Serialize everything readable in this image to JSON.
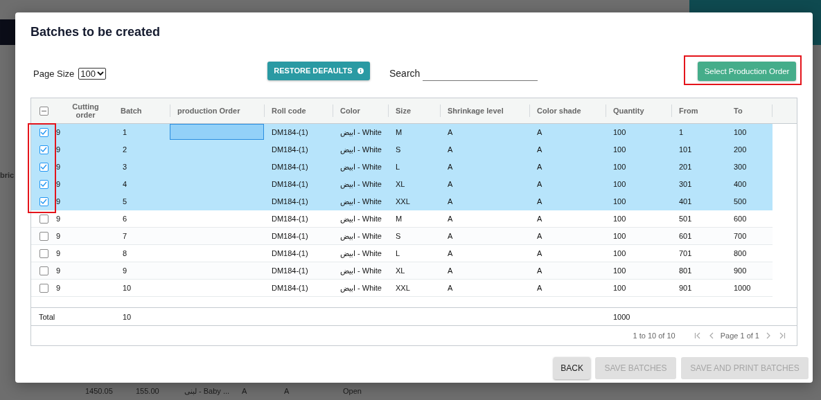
{
  "background": {
    "column_label": "bric",
    "row": [
      "1450.05",
      "155.00",
      "لبنى - Baby ...",
      "A",
      "A",
      "Open"
    ]
  },
  "dialog": {
    "title": "Batches to be created",
    "page_size": {
      "label": "Page Size",
      "value": "100"
    },
    "restore_button": "RESTORE DEFAULTS",
    "search": {
      "label": "Search"
    },
    "select_po_button": "Select Production Order",
    "table": {
      "select_all": {
        "indeterminate": true
      },
      "columns": [
        {
          "label": "Cutting order",
          "kind": "text"
        },
        {
          "label": "Batch",
          "kind": "text"
        },
        {
          "label": "production Order",
          "kind": "editable"
        },
        {
          "label": "Roll code",
          "kind": "text"
        },
        {
          "label": "Color",
          "kind": "text"
        },
        {
          "label": "Size",
          "kind": "text"
        },
        {
          "label": "Shrinkage level",
          "kind": "text"
        },
        {
          "label": "Color shade",
          "kind": "text"
        },
        {
          "label": "Quantity",
          "kind": "text"
        },
        {
          "label": "From",
          "kind": "text"
        },
        {
          "label": "To",
          "kind": "text"
        }
      ],
      "rows": [
        {
          "selected": true,
          "editing": true,
          "cells": [
            "9",
            "1",
            "",
            "DM184-(1)",
            "ابيض - White",
            "M",
            "A",
            "A",
            "100",
            "1",
            "100"
          ]
        },
        {
          "selected": true,
          "editing": false,
          "cells": [
            "9",
            "2",
            "",
            "DM184-(1)",
            "ابيض - White",
            "S",
            "A",
            "A",
            "100",
            "101",
            "200"
          ]
        },
        {
          "selected": true,
          "editing": false,
          "cells": [
            "9",
            "3",
            "",
            "DM184-(1)",
            "ابيض - White",
            "L",
            "A",
            "A",
            "100",
            "201",
            "300"
          ]
        },
        {
          "selected": true,
          "editing": false,
          "cells": [
            "9",
            "4",
            "",
            "DM184-(1)",
            "ابيض - White",
            "XL",
            "A",
            "A",
            "100",
            "301",
            "400"
          ]
        },
        {
          "selected": true,
          "editing": false,
          "cells": [
            "9",
            "5",
            "",
            "DM184-(1)",
            "ابيض - White",
            "XXL",
            "A",
            "A",
            "100",
            "401",
            "500"
          ]
        },
        {
          "selected": false,
          "editing": false,
          "cells": [
            "9",
            "6",
            "",
            "DM184-(1)",
            "ابيض - White",
            "M",
            "A",
            "A",
            "100",
            "501",
            "600"
          ]
        },
        {
          "selected": false,
          "editing": false,
          "cells": [
            "9",
            "7",
            "",
            "DM184-(1)",
            "ابيض - White",
            "S",
            "A",
            "A",
            "100",
            "601",
            "700"
          ]
        },
        {
          "selected": false,
          "editing": false,
          "cells": [
            "9",
            "8",
            "",
            "DM184-(1)",
            "ابيض - White",
            "L",
            "A",
            "A",
            "100",
            "701",
            "800"
          ]
        },
        {
          "selected": false,
          "editing": false,
          "cells": [
            "9",
            "9",
            "",
            "DM184-(1)",
            "ابيض - White",
            "XL",
            "A",
            "A",
            "100",
            "801",
            "900"
          ]
        },
        {
          "selected": false,
          "editing": false,
          "cells": [
            "9",
            "10",
            "",
            "DM184-(1)",
            "ابيض - White",
            "XXL",
            "A",
            "A",
            "100",
            "901",
            "1000"
          ]
        }
      ],
      "totals": {
        "label": "Total",
        "batch": "10",
        "quantity": "1000"
      },
      "pagination": {
        "range": "1 to 10 of 10",
        "page": "Page 1 of 1"
      }
    },
    "buttons": [
      {
        "label": "BACK",
        "disabled": false
      },
      {
        "label": "SAVE BATCHES",
        "disabled": true
      },
      {
        "label": "SAVE AND PRINT BATCHES",
        "disabled": true
      }
    ]
  }
}
